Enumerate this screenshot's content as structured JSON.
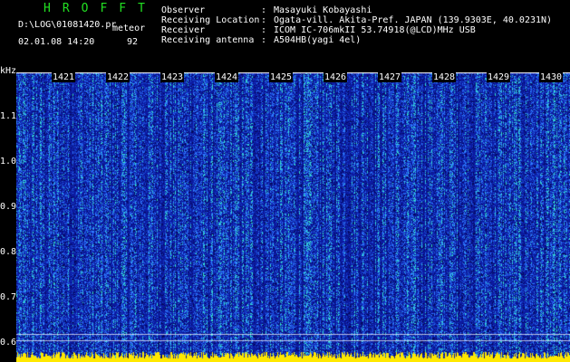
{
  "header": {
    "app_title": "HROFFT",
    "log_path": "D:\\LOG\\01081420.pr",
    "mode": "meteor",
    "datetime": "02.01.08 14:20",
    "count": "92"
  },
  "info": [
    {
      "label": "Observer",
      "sep": ":",
      "value": "Masayuki Kobayashi"
    },
    {
      "label": "Receiving Location",
      "sep": ":",
      "value": "Ogata-vill. Akita-Pref. JAPAN (139.9303E, 40.0231N)"
    },
    {
      "label": "Receiver",
      "sep": ":",
      "value": "ICOM IC-706mkII 53.74918(@LCD)MHz USB"
    },
    {
      "label": "Receiving antenna",
      "sep": ":",
      "value": "A504HB(yagi 4el)"
    }
  ],
  "axis": {
    "y_unit": "kHz",
    "y_ticks": [
      "1.1",
      "1.0",
      "0.9",
      "0.8",
      "0.7",
      "0.6"
    ],
    "x_ticks": [
      "1421",
      "1422",
      "1423",
      "1424",
      "1425",
      "1426",
      "1427",
      "1428",
      "1429",
      "1430"
    ]
  },
  "colors": {
    "background": "#000000",
    "title_green": "#22e022",
    "text_white": "#ffffff",
    "spectro_base": "#0c1aa0",
    "spectro_noise": "#2f7bff",
    "spectro_hot": "#33e0d0",
    "baseline_yellow": "#ffe800"
  }
}
